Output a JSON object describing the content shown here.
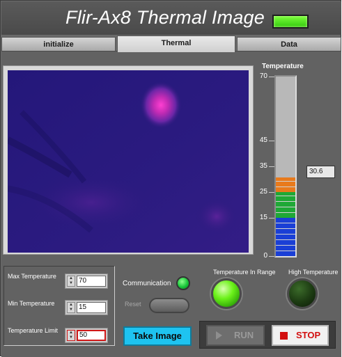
{
  "app": {
    "title": "Flir-Ax8 Thermal Image"
  },
  "tabs": [
    {
      "label": "initialize",
      "active": false
    },
    {
      "label": "Thermal",
      "active": true
    },
    {
      "label": "Data",
      "active": false
    }
  ],
  "temperature_gauge": {
    "title": "Temperature",
    "scale_labels": [
      "70",
      "45",
      "35",
      "25",
      "15",
      "0"
    ],
    "scale_values": [
      70,
      45,
      35,
      25,
      15,
      0
    ],
    "min": 0,
    "max": 70,
    "value": 30.6,
    "value_display": "30.6",
    "color_bands": [
      {
        "from": 0,
        "to": 15,
        "color": "#1a3fd6"
      },
      {
        "from": 15,
        "to": 25,
        "color": "#1fa836"
      },
      {
        "from": 25,
        "to": 30.6,
        "color": "#e87a1c"
      }
    ]
  },
  "controls": {
    "max_temperature": {
      "label": "Max Temperature",
      "value": "70"
    },
    "min_temperature": {
      "label": "Min Temperature",
      "value": "15"
    },
    "temperature_limit": {
      "label": "Temperature Limit",
      "value": "50"
    }
  },
  "communication": {
    "label": "Communication",
    "status": "on"
  },
  "reset": {
    "label": "Reset"
  },
  "take_image": {
    "label": "Take Image"
  },
  "indicators": {
    "in_range": {
      "label": "Temperature In Range",
      "state": "on"
    },
    "high_temperature": {
      "label": "High Temperature",
      "state": "off"
    }
  },
  "run_button": {
    "label": "RUN",
    "enabled": false
  },
  "stop_button": {
    "label": "STOP"
  },
  "colors": {
    "panel": "#6b6b6b",
    "thermal_background": "#2a1a7c",
    "hotspot": "#e43cc8",
    "take_image": "#1ec3f0"
  },
  "icons": {
    "run": "play-icon",
    "stop": "stop-square-icon"
  }
}
